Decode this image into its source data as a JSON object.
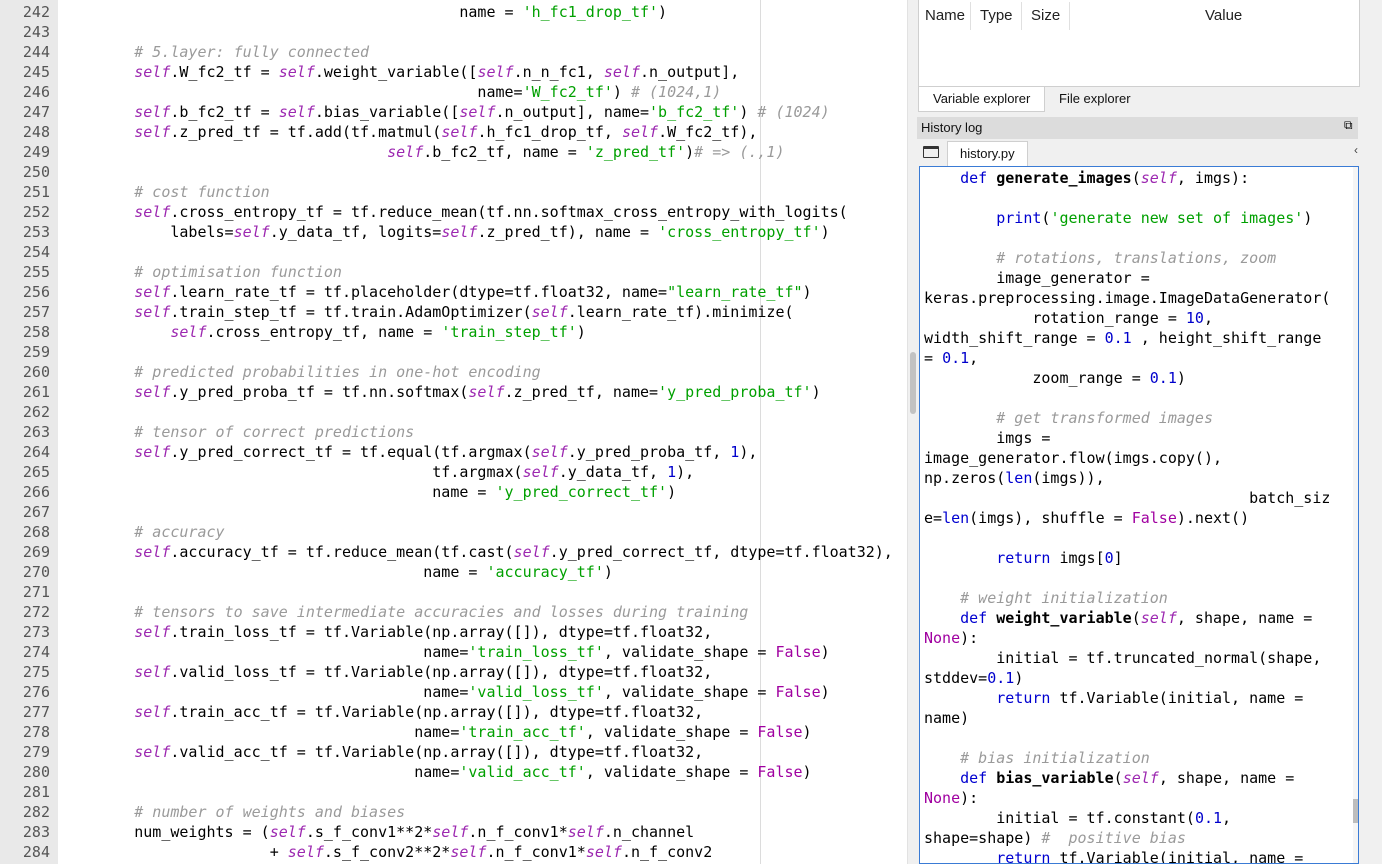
{
  "editor": {
    "lines": [
      {
        "n": "242",
        "parts": [
          [
            "t",
            "                                            name = "
          ],
          [
            "st",
            "'h_fc1_drop_tf'"
          ],
          [
            "t",
            ")"
          ]
        ]
      },
      {
        "n": "243",
        "parts": []
      },
      {
        "n": "244",
        "parts": [
          [
            "t",
            "        "
          ],
          [
            "cm",
            "# 5.layer: fully connected"
          ]
        ]
      },
      {
        "n": "245",
        "parts": [
          [
            "t",
            "        "
          ],
          [
            "sf",
            "self"
          ],
          [
            "t",
            ".W_fc2_tf = "
          ],
          [
            "sf",
            "self"
          ],
          [
            "t",
            ".weight_variable(["
          ],
          [
            "sf",
            "self"
          ],
          [
            "t",
            ".n_n_fc1, "
          ],
          [
            "sf",
            "self"
          ],
          [
            "t",
            ".n_output],"
          ]
        ]
      },
      {
        "n": "246",
        "parts": [
          [
            "t",
            "                                              name="
          ],
          [
            "st",
            "'W_fc2_tf'"
          ],
          [
            "t",
            ") "
          ],
          [
            "cm",
            "# (1024,1)"
          ]
        ]
      },
      {
        "n": "247",
        "parts": [
          [
            "t",
            "        "
          ],
          [
            "sf",
            "self"
          ],
          [
            "t",
            ".b_fc2_tf = "
          ],
          [
            "sf",
            "self"
          ],
          [
            "t",
            ".bias_variable(["
          ],
          [
            "sf",
            "self"
          ],
          [
            "t",
            ".n_output], name="
          ],
          [
            "st",
            "'b_fc2_tf'"
          ],
          [
            "t",
            ") "
          ],
          [
            "cm",
            "# (1024)"
          ]
        ]
      },
      {
        "n": "248",
        "parts": [
          [
            "t",
            "        "
          ],
          [
            "sf",
            "self"
          ],
          [
            "t",
            ".z_pred_tf = tf.add(tf.matmul("
          ],
          [
            "sf",
            "self"
          ],
          [
            "t",
            ".h_fc1_drop_tf, "
          ],
          [
            "sf",
            "self"
          ],
          [
            "t",
            ".W_fc2_tf),"
          ]
        ]
      },
      {
        "n": "249",
        "parts": [
          [
            "t",
            "                                    "
          ],
          [
            "sf",
            "self"
          ],
          [
            "t",
            ".b_fc2_tf, name = "
          ],
          [
            "st",
            "'z_pred_tf'"
          ],
          [
            "t",
            ")"
          ],
          [
            "cm",
            "# => (.,1)"
          ]
        ]
      },
      {
        "n": "250",
        "parts": []
      },
      {
        "n": "251",
        "parts": [
          [
            "t",
            "        "
          ],
          [
            "cm",
            "# cost function"
          ]
        ]
      },
      {
        "n": "252",
        "parts": [
          [
            "t",
            "        "
          ],
          [
            "sf",
            "self"
          ],
          [
            "t",
            ".cross_entropy_tf = tf.reduce_mean(tf.nn.softmax_cross_entropy_with_logits("
          ]
        ]
      },
      {
        "n": "253",
        "parts": [
          [
            "t",
            "            labels="
          ],
          [
            "sf",
            "self"
          ],
          [
            "t",
            ".y_data_tf, logits="
          ],
          [
            "sf",
            "self"
          ],
          [
            "t",
            ".z_pred_tf), name = "
          ],
          [
            "st",
            "'cross_entropy_tf'"
          ],
          [
            "t",
            ")"
          ]
        ]
      },
      {
        "n": "254",
        "parts": []
      },
      {
        "n": "255",
        "parts": [
          [
            "t",
            "        "
          ],
          [
            "cm",
            "# optimisation function"
          ]
        ]
      },
      {
        "n": "256",
        "parts": [
          [
            "t",
            "        "
          ],
          [
            "sf",
            "self"
          ],
          [
            "t",
            ".learn_rate_tf = tf.placeholder(dtype=tf.float32, name="
          ],
          [
            "st",
            "\"learn_rate_tf\""
          ],
          [
            "t",
            ")"
          ]
        ]
      },
      {
        "n": "257",
        "parts": [
          [
            "t",
            "        "
          ],
          [
            "sf",
            "self"
          ],
          [
            "t",
            ".train_step_tf = tf.train.AdamOptimizer("
          ],
          [
            "sf",
            "self"
          ],
          [
            "t",
            ".learn_rate_tf).minimize("
          ]
        ]
      },
      {
        "n": "258",
        "parts": [
          [
            "t",
            "            "
          ],
          [
            "sf",
            "self"
          ],
          [
            "t",
            ".cross_entropy_tf, name = "
          ],
          [
            "st",
            "'train_step_tf'"
          ],
          [
            "t",
            ")"
          ]
        ]
      },
      {
        "n": "259",
        "parts": []
      },
      {
        "n": "260",
        "parts": [
          [
            "t",
            "        "
          ],
          [
            "cm",
            "# predicted probabilities in one-hot encoding"
          ]
        ]
      },
      {
        "n": "261",
        "parts": [
          [
            "t",
            "        "
          ],
          [
            "sf",
            "self"
          ],
          [
            "t",
            ".y_pred_proba_tf = tf.nn.softmax("
          ],
          [
            "sf",
            "self"
          ],
          [
            "t",
            ".z_pred_tf, name="
          ],
          [
            "st",
            "'y_pred_proba_tf'"
          ],
          [
            "t",
            ")"
          ]
        ]
      },
      {
        "n": "262",
        "parts": []
      },
      {
        "n": "263",
        "parts": [
          [
            "t",
            "        "
          ],
          [
            "cm",
            "# tensor of correct predictions"
          ]
        ]
      },
      {
        "n": "264",
        "parts": [
          [
            "t",
            "        "
          ],
          [
            "sf",
            "self"
          ],
          [
            "t",
            ".y_pred_correct_tf = tf.equal(tf.argmax("
          ],
          [
            "sf",
            "self"
          ],
          [
            "t",
            ".y_pred_proba_tf, "
          ],
          [
            "nm",
            "1"
          ],
          [
            "t",
            "),"
          ]
        ]
      },
      {
        "n": "265",
        "parts": [
          [
            "t",
            "                                         tf.argmax("
          ],
          [
            "sf",
            "self"
          ],
          [
            "t",
            ".y_data_tf, "
          ],
          [
            "nm",
            "1"
          ],
          [
            "t",
            "),"
          ]
        ]
      },
      {
        "n": "266",
        "parts": [
          [
            "t",
            "                                         name = "
          ],
          [
            "st",
            "'y_pred_correct_tf'"
          ],
          [
            "t",
            ")"
          ]
        ]
      },
      {
        "n": "267",
        "parts": []
      },
      {
        "n": "268",
        "parts": [
          [
            "t",
            "        "
          ],
          [
            "cm",
            "# accuracy"
          ]
        ]
      },
      {
        "n": "269",
        "parts": [
          [
            "t",
            "        "
          ],
          [
            "sf",
            "self"
          ],
          [
            "t",
            ".accuracy_tf = tf.reduce_mean(tf.cast("
          ],
          [
            "sf",
            "self"
          ],
          [
            "t",
            ".y_pred_correct_tf, dtype=tf.float32),"
          ]
        ]
      },
      {
        "n": "270",
        "parts": [
          [
            "t",
            "                                        name = "
          ],
          [
            "st",
            "'accuracy_tf'"
          ],
          [
            "t",
            ")"
          ]
        ]
      },
      {
        "n": "271",
        "parts": []
      },
      {
        "n": "272",
        "parts": [
          [
            "t",
            "        "
          ],
          [
            "cm",
            "# tensors to save intermediate accuracies and losses during training"
          ]
        ]
      },
      {
        "n": "273",
        "parts": [
          [
            "t",
            "        "
          ],
          [
            "sf",
            "self"
          ],
          [
            "t",
            ".train_loss_tf = tf.Variable(np.array([]), dtype=tf.float32,"
          ]
        ]
      },
      {
        "n": "274",
        "parts": [
          [
            "t",
            "                                        name="
          ],
          [
            "st",
            "'train_loss_tf'"
          ],
          [
            "t",
            ", validate_shape = "
          ],
          [
            "kc",
            "False"
          ],
          [
            "t",
            ")"
          ]
        ]
      },
      {
        "n": "275",
        "parts": [
          [
            "t",
            "        "
          ],
          [
            "sf",
            "self"
          ],
          [
            "t",
            ".valid_loss_tf = tf.Variable(np.array([]), dtype=tf.float32,"
          ]
        ]
      },
      {
        "n": "276",
        "parts": [
          [
            "t",
            "                                        name="
          ],
          [
            "st",
            "'valid_loss_tf'"
          ],
          [
            "t",
            ", validate_shape = "
          ],
          [
            "kc",
            "False"
          ],
          [
            "t",
            ")"
          ]
        ]
      },
      {
        "n": "277",
        "parts": [
          [
            "t",
            "        "
          ],
          [
            "sf",
            "self"
          ],
          [
            "t",
            ".train_acc_tf = tf.Variable(np.array([]), dtype=tf.float32,"
          ]
        ]
      },
      {
        "n": "278",
        "parts": [
          [
            "t",
            "                                       name="
          ],
          [
            "st",
            "'train_acc_tf'"
          ],
          [
            "t",
            ", validate_shape = "
          ],
          [
            "kc",
            "False"
          ],
          [
            "t",
            ")"
          ]
        ]
      },
      {
        "n": "279",
        "parts": [
          [
            "t",
            "        "
          ],
          [
            "sf",
            "self"
          ],
          [
            "t",
            ".valid_acc_tf = tf.Variable(np.array([]), dtype=tf.float32,"
          ]
        ]
      },
      {
        "n": "280",
        "parts": [
          [
            "t",
            "                                       name="
          ],
          [
            "st",
            "'valid_acc_tf'"
          ],
          [
            "t",
            ", validate_shape = "
          ],
          [
            "kc",
            "False"
          ],
          [
            "t",
            ")"
          ]
        ]
      },
      {
        "n": "281",
        "parts": []
      },
      {
        "n": "282",
        "parts": [
          [
            "t",
            "        "
          ],
          [
            "cm",
            "# number of weights and biases"
          ]
        ]
      },
      {
        "n": "283",
        "parts": [
          [
            "t",
            "        num_weights = ("
          ],
          [
            "sf",
            "self"
          ],
          [
            "t",
            ".s_f_conv1**2*"
          ],
          [
            "sf",
            "self"
          ],
          [
            "t",
            ".n_f_conv1*"
          ],
          [
            "sf",
            "self"
          ],
          [
            "t",
            ".n_channel"
          ]
        ]
      },
      {
        "n": "284",
        "parts": [
          [
            "t",
            "                       + "
          ],
          [
            "sf",
            "self"
          ],
          [
            "t",
            ".s_f_conv2**2*"
          ],
          [
            "sf",
            "self"
          ],
          [
            "t",
            ".n_f_conv1*"
          ],
          [
            "sf",
            "self"
          ],
          [
            "t",
            ".n_f_conv2"
          ]
        ]
      }
    ]
  },
  "variable_explorer": {
    "columns": [
      "Name",
      "Type",
      "Size",
      "Value"
    ]
  },
  "tabs": {
    "variable_explorer": "Variable explorer",
    "file_explorer": "File explorer"
  },
  "history": {
    "title": "History log",
    "file_tab": "history.py",
    "lines": [
      [
        [
          "t",
          "    "
        ],
        [
          "kw",
          "def "
        ],
        [
          "fn",
          "generate_images"
        ],
        [
          "t",
          "("
        ],
        [
          "sf",
          "self"
        ],
        [
          "t",
          ", imgs):"
        ]
      ],
      [],
      [
        [
          "t",
          "        "
        ],
        [
          "kw",
          "print"
        ],
        [
          "t",
          "("
        ],
        [
          "st",
          "'generate new set of images'"
        ],
        [
          "t",
          ")"
        ]
      ],
      [],
      [
        [
          "t",
          "        "
        ],
        [
          "cm",
          "# rotations, translations, zoom"
        ]
      ],
      [
        [
          "t",
          "        image_generator ="
        ]
      ],
      [
        [
          "t",
          "keras.preprocessing.image.ImageDataGenerator("
        ]
      ],
      [
        [
          "t",
          "            rotation_range = "
        ],
        [
          "nm",
          "10"
        ],
        [
          "t",
          ","
        ]
      ],
      [
        [
          "t",
          "width_shift_range = "
        ],
        [
          "nm",
          "0.1"
        ],
        [
          "t",
          " , height_shift_range"
        ]
      ],
      [
        [
          "t",
          "= "
        ],
        [
          "nm",
          "0.1"
        ],
        [
          "t",
          ","
        ]
      ],
      [
        [
          "t",
          "            zoom_range = "
        ],
        [
          "nm",
          "0.1"
        ],
        [
          "t",
          ")"
        ]
      ],
      [],
      [
        [
          "t",
          "        "
        ],
        [
          "cm",
          "# get transformed images"
        ]
      ],
      [
        [
          "t",
          "        imgs ="
        ]
      ],
      [
        [
          "t",
          "image_generator.flow(imgs.copy(),"
        ]
      ],
      [
        [
          "t",
          "np.zeros("
        ],
        [
          "kw",
          "len"
        ],
        [
          "t",
          "(imgs)),"
        ]
      ],
      [
        [
          "t",
          "                                    batch_siz"
        ]
      ],
      [
        [
          "t",
          "e="
        ],
        [
          "kw",
          "len"
        ],
        [
          "t",
          "(imgs), shuffle = "
        ],
        [
          "kc",
          "False"
        ],
        [
          "t",
          ").next()"
        ]
      ],
      [],
      [
        [
          "t",
          "        "
        ],
        [
          "kw",
          "return"
        ],
        [
          "t",
          " imgs["
        ],
        [
          "nm",
          "0"
        ],
        [
          "t",
          "]"
        ]
      ],
      [],
      [
        [
          "t",
          "    "
        ],
        [
          "cm",
          "# weight initialization"
        ]
      ],
      [
        [
          "t",
          "    "
        ],
        [
          "kw",
          "def "
        ],
        [
          "fn",
          "weight_variable"
        ],
        [
          "t",
          "("
        ],
        [
          "sf",
          "self"
        ],
        [
          "t",
          ", shape, name ="
        ]
      ],
      [
        [
          "kc",
          "None"
        ],
        [
          "t",
          "):"
        ]
      ],
      [
        [
          "t",
          "        initial = tf.truncated_normal(shape,"
        ]
      ],
      [
        [
          "t",
          "stddev="
        ],
        [
          "nm",
          "0.1"
        ],
        [
          "t",
          ")"
        ]
      ],
      [
        [
          "t",
          "        "
        ],
        [
          "kw",
          "return"
        ],
        [
          "t",
          " tf.Variable(initial, name ="
        ]
      ],
      [
        [
          "t",
          "name)"
        ]
      ],
      [],
      [
        [
          "t",
          "    "
        ],
        [
          "cm",
          "# bias initialization"
        ]
      ],
      [
        [
          "t",
          "    "
        ],
        [
          "kw",
          "def "
        ],
        [
          "fn",
          "bias_variable"
        ],
        [
          "t",
          "("
        ],
        [
          "sf",
          "self"
        ],
        [
          "t",
          ", shape, name ="
        ]
      ],
      [
        [
          "kc",
          "None"
        ],
        [
          "t",
          "):"
        ]
      ],
      [
        [
          "t",
          "        initial = tf.constant("
        ],
        [
          "nm",
          "0.1"
        ],
        [
          "t",
          ","
        ]
      ],
      [
        [
          "t",
          "shape=shape) "
        ],
        [
          "cm",
          "#  positive bias"
        ]
      ],
      [
        [
          "t",
          "        "
        ],
        [
          "kw",
          "return"
        ],
        [
          "t",
          " tf.Variable(initial, name ="
        ]
      ]
    ]
  }
}
